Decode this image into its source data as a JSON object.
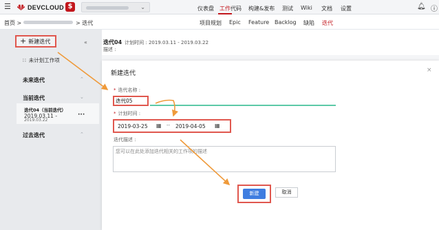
{
  "topbar": {
    "menu_icon": "hamburger-icon",
    "brand": "DEVCLOUD",
    "project_badge": "$",
    "nav": [
      "仪表盘",
      "工作",
      "代码",
      "构建&发布",
      "测试",
      "Wiki",
      "文档",
      "设置"
    ],
    "active_nav": "工作",
    "bell_icon": "bell-icon",
    "help_icon": "help-icon",
    "colors": {
      "accent": "#c2161c",
      "highlight": "#e0574e",
      "primary": "#3f7de0"
    }
  },
  "subbar": {
    "breadcrumb_home": "首页 >",
    "breadcrumb_current": "> 迭代",
    "tabs": [
      "项目规划",
      "Epic",
      "Feature",
      "Backlog",
      "缺陷",
      "迭代"
    ],
    "active_tab": "迭代"
  },
  "sidebar": {
    "new_iteration": "新建迭代",
    "unplanned": "未计划工作项",
    "future": "未来迭代",
    "current": "当前迭代",
    "current_item": {
      "title": "迭代04（当前迭代）",
      "date1": "2019.03.11 -",
      "date2": "2019.03.22"
    },
    "past": "过去迭代"
  },
  "main": {
    "iteration_name": "迭代04",
    "plan_time": "计划时间 : 2019.03.11 - 2019.03.22",
    "desc_label": "描述 :"
  },
  "dialog": {
    "title": "新建迭代",
    "close": "×",
    "name_label": "迭代名称 :",
    "name_value": "迭代05",
    "time_label": "计划时间 :",
    "start_date": "2019-03-25",
    "end_date": "2019-04-05",
    "date_separator": "--",
    "desc_label": "迭代描述 :",
    "desc_placeholder": "您可以在此处添加迭代相关的工作项的描述",
    "ok": "新建",
    "cancel": "取消"
  }
}
